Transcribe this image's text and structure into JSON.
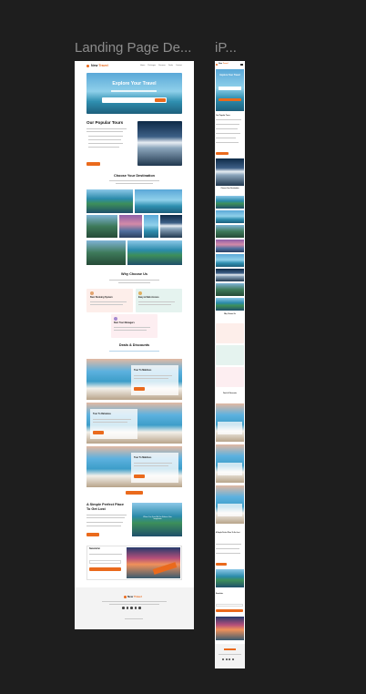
{
  "canvas": {
    "frames": [
      {
        "label": "Landing Page De..."
      },
      {
        "label": "iP..."
      }
    ]
  },
  "desktop": {
    "brand": {
      "name_a": "New",
      "name_b": "Travel"
    },
    "nav": [
      "Home",
      "Packages",
      "Discover",
      "Deals",
      "Contact"
    ],
    "hero": {
      "title": "Explore Your Travel"
    },
    "popular": {
      "title": "Our Popular Tours"
    },
    "destination": {
      "title": "Choose Your Destination"
    },
    "why": {
      "title": "Why Choose Us",
      "items": [
        {
          "title": "Best Booking System"
        },
        {
          "title": "Easy & Safe Access"
        },
        {
          "title": "Best Tour Managers"
        }
      ]
    },
    "deals": {
      "title": "Deals & Discounts",
      "cards": [
        {
          "title": "Tour To Maldives"
        },
        {
          "title": "Tour To Bahamas"
        },
        {
          "title": "Tour To Maldives"
        }
      ]
    },
    "perfect": {
      "title": "A Simple Perfect Place To Get Lost",
      "image_caption": "Where Can Great Be Fun Balance Your Imagination"
    },
    "newsletter": {
      "title": "Newsletter"
    },
    "footer": {
      "brand_a": "New",
      "brand_b": "Travel"
    }
  },
  "mobile": {
    "brand": {
      "name_a": "New",
      "name_b": "Travel"
    },
    "hero": {
      "title": "Explore Your Travel"
    },
    "popular": {
      "title": "Our Popular Tours"
    },
    "destination": {
      "title": "Choose Your Destination"
    },
    "why": {
      "title": "Why Choose Us"
    },
    "deals": {
      "title": "Deals & Discounts"
    },
    "perfect": {
      "title": "A Simple Perfect Place To Get Lost"
    },
    "newsletter": {
      "title": "Newsletter"
    }
  },
  "colors": {
    "accent": "#ea6a1c",
    "canvas": "#1e1e1e",
    "frame_label": "#8c8c8c"
  }
}
